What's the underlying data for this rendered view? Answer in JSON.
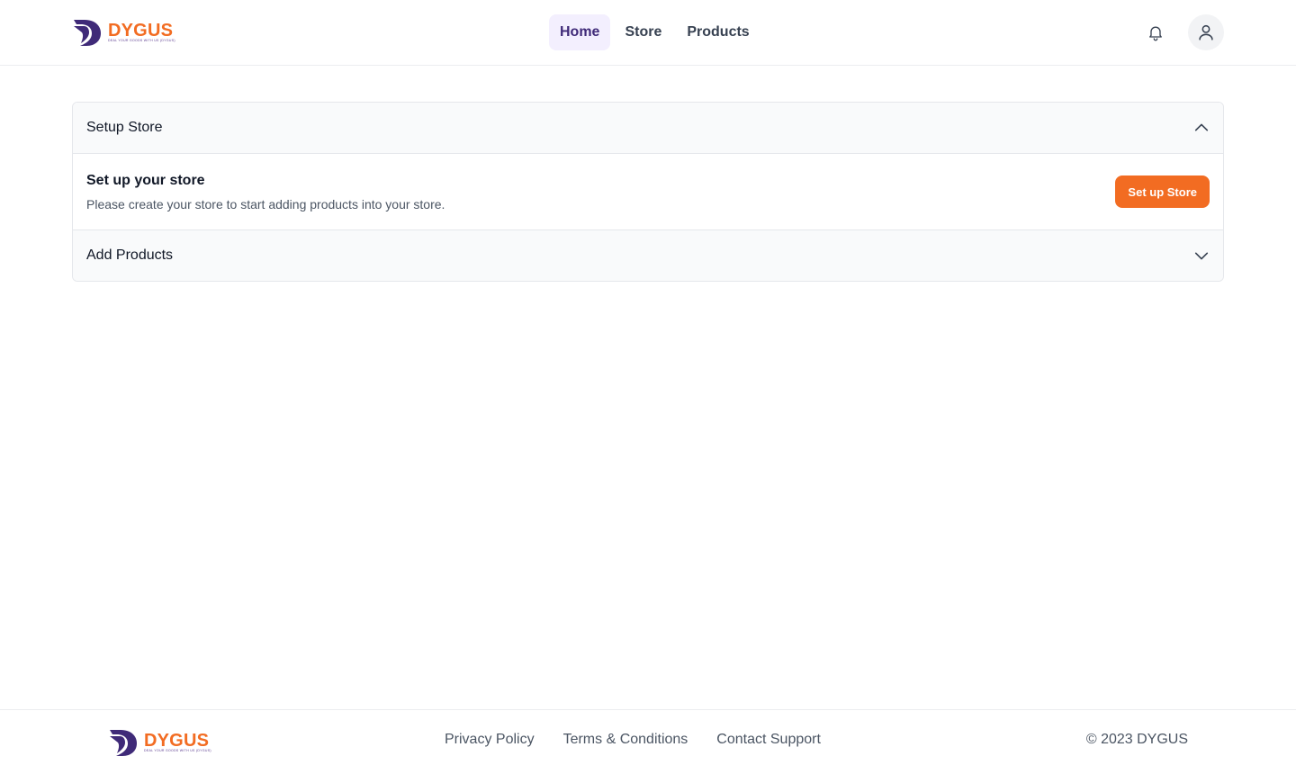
{
  "brand": {
    "name": "DYGUS",
    "tagline": "DEAL YOUR GOODS WITH US (DYGUS)",
    "colors": {
      "primary": "#F26C22",
      "secondary": "#3F2A78"
    }
  },
  "nav": {
    "items": [
      {
        "label": "Home",
        "active": true
      },
      {
        "label": "Store",
        "active": false
      },
      {
        "label": "Products",
        "active": false
      }
    ]
  },
  "header_icons": {
    "notifications": "bell-icon",
    "profile": "user-icon"
  },
  "accordion": {
    "sections": [
      {
        "title": "Setup Store",
        "expanded": true,
        "body_title": "Set up your store",
        "body_description": "Please create your store to start adding products into your store.",
        "button_label": "Set up Store"
      },
      {
        "title": "Add Products",
        "expanded": false
      }
    ]
  },
  "footer": {
    "links": [
      "Privacy Policy",
      "Terms & Conditions",
      "Contact Support"
    ],
    "copyright": "© 2023 DYGUS"
  }
}
